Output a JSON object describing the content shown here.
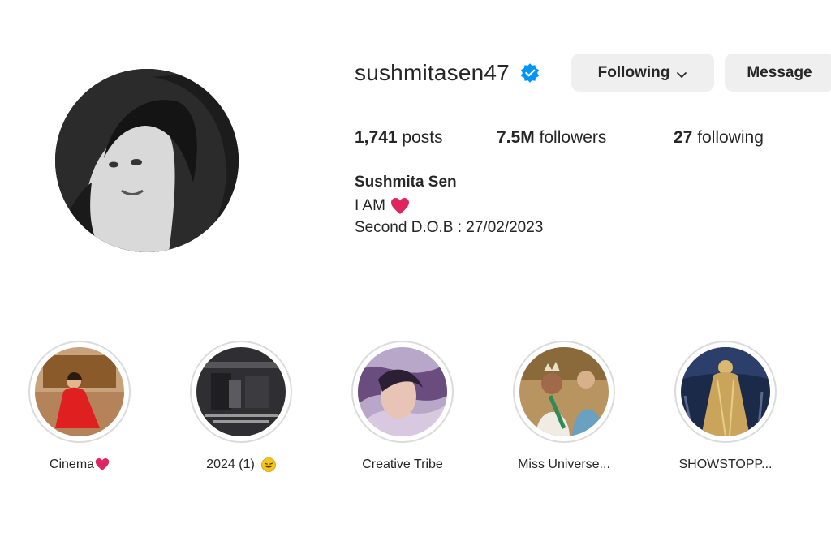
{
  "profile": {
    "username": "sushmitasen47",
    "verified": true,
    "following_button": "Following",
    "message_button": "Message",
    "posts_count": "1,741",
    "posts_label": "posts",
    "followers_count": "7.5M",
    "followers_label": "followers",
    "following_count": "27",
    "following_label": "following",
    "full_name": "Sushmita Sen",
    "bio_line1": "I AM",
    "bio_line2": "Second D.O.B : 27/02/2023"
  },
  "highlights": [
    {
      "label": "Cinema"
    },
    {
      "label": "2024 (1)"
    },
    {
      "label": "Creative Tribe"
    },
    {
      "label": "Miss Universe..."
    },
    {
      "label": "SHOWSTOPP..."
    }
  ],
  "colors": {
    "verified_blue": "#0095f6",
    "heart_red": "#e0245e",
    "button_bg": "#efefef",
    "ring_border": "#dbdbdb"
  },
  "icons": {
    "verified": "verified-badge-icon",
    "chevron": "chevron-down-icon",
    "heart": "red-heart-emoji-icon",
    "laugh": "laughing-emoji-icon"
  }
}
